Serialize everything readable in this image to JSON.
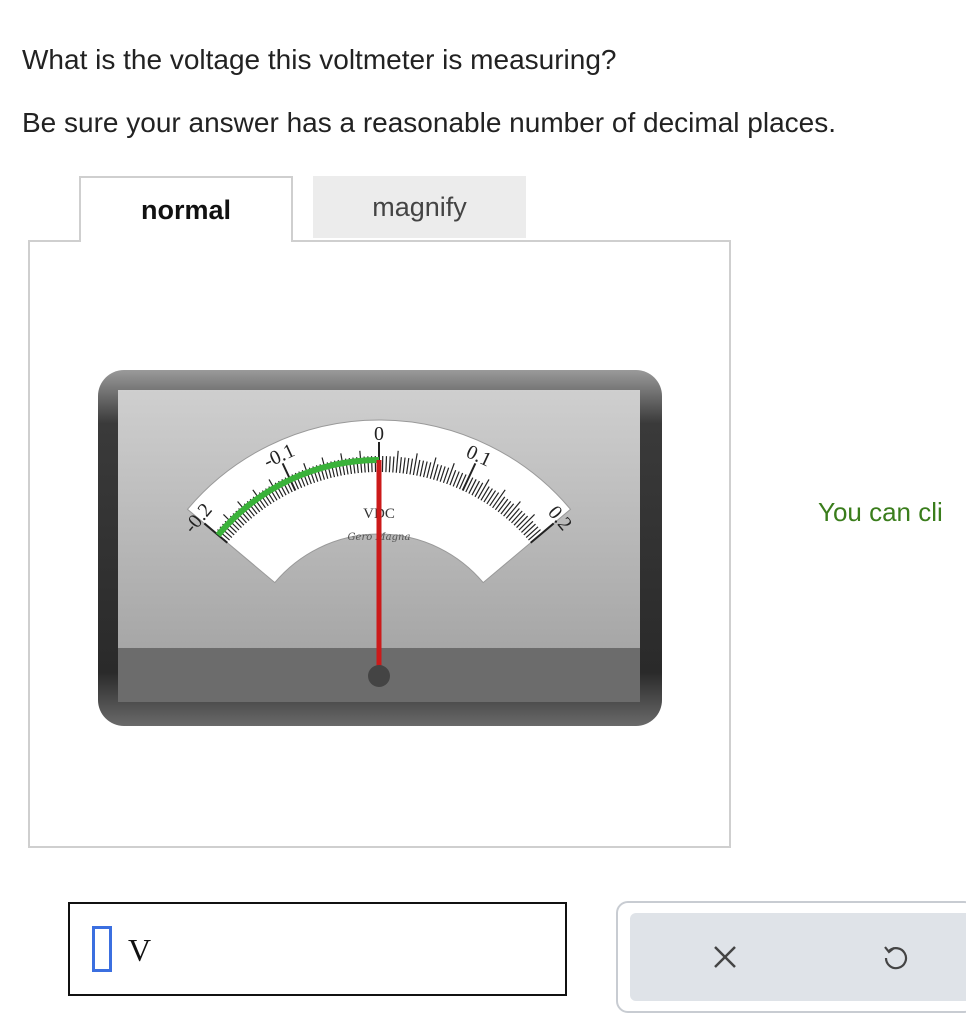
{
  "question": {
    "line1": "What is the voltage this voltmeter is measuring?",
    "line2": "Be sure your answer has a reasonable number of decimal places."
  },
  "tabs": [
    {
      "label": "normal",
      "selected": true
    },
    {
      "label": "magnify",
      "selected": false
    }
  ],
  "meter": {
    "scale_labels": [
      "-0.2",
      "-0.1",
      "0",
      "0.1",
      "0.2"
    ],
    "range": [
      -0.2,
      0.2
    ],
    "needle_value": 0.0,
    "unit_label": "VDC",
    "maker_label": "Gero Magna",
    "colors": {
      "needle": "#cc1a1a",
      "green_band": "#3ab23a"
    }
  },
  "hint_text": "You can cli",
  "answer": {
    "value": "",
    "unit": "V"
  },
  "buttons": {
    "clear_icon": "close-icon",
    "undo_icon": "undo-icon"
  }
}
